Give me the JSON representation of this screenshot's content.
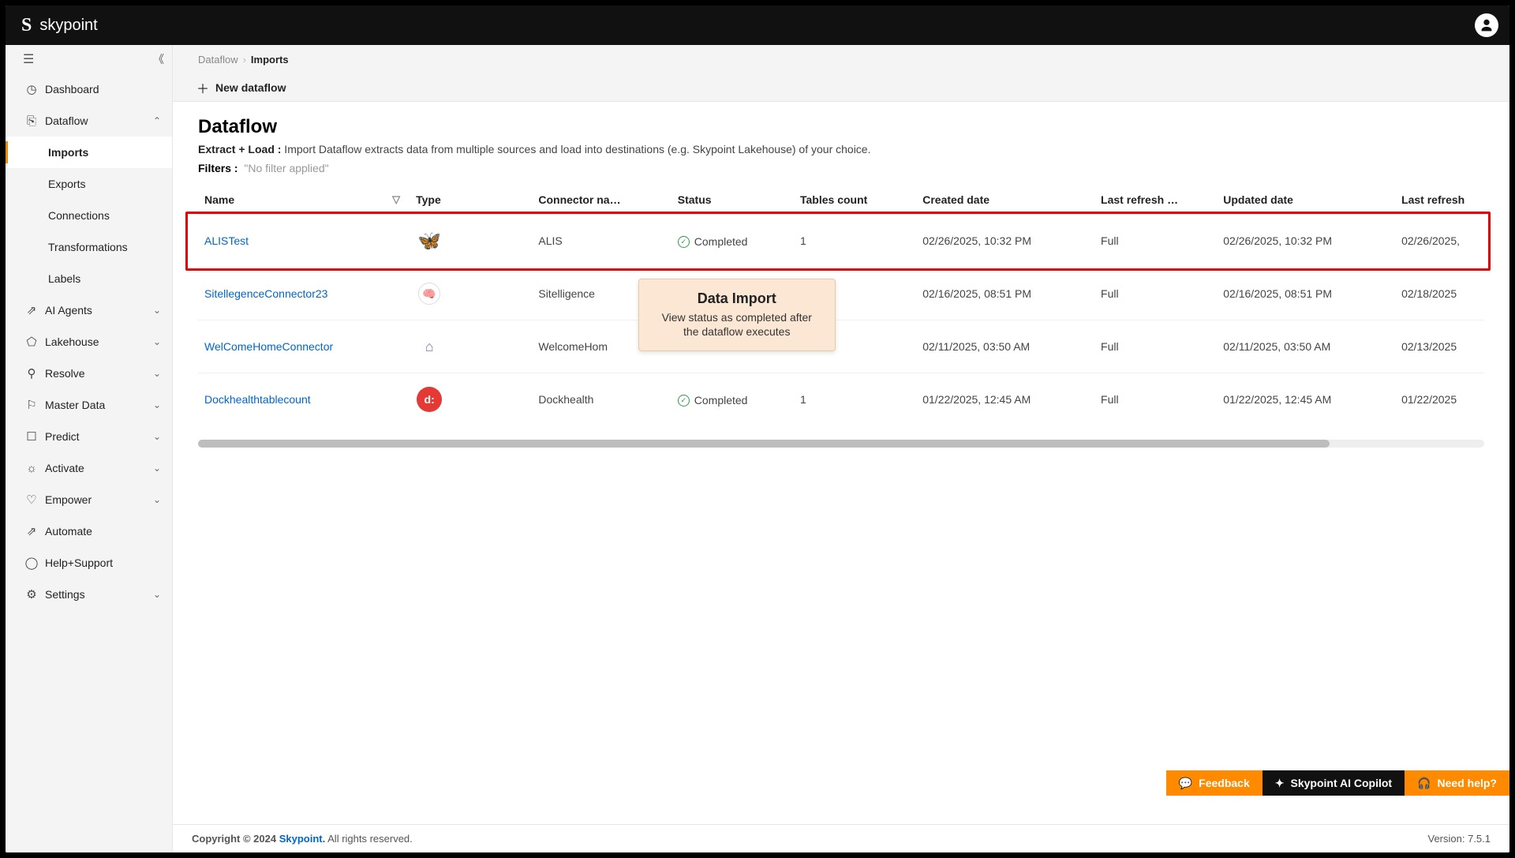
{
  "brand": {
    "logo": "S",
    "name": "skypoint"
  },
  "sidebar": {
    "items": [
      {
        "icon": "gauge",
        "label": "Dashboard",
        "expand": ""
      },
      {
        "icon": "flow",
        "label": "Dataflow",
        "expand": "up",
        "children": [
          {
            "label": "Imports",
            "active": true
          },
          {
            "label": "Exports"
          },
          {
            "label": "Connections"
          },
          {
            "label": "Transformations"
          },
          {
            "label": "Labels"
          }
        ]
      },
      {
        "icon": "agents",
        "label": "AI Agents",
        "expand": "down"
      },
      {
        "icon": "cube",
        "label": "Lakehouse",
        "expand": "down"
      },
      {
        "icon": "resolve",
        "label": "Resolve",
        "expand": "down"
      },
      {
        "icon": "people",
        "label": "Master Data",
        "expand": "down"
      },
      {
        "icon": "predict",
        "label": "Predict",
        "expand": "down"
      },
      {
        "icon": "bulb",
        "label": "Activate",
        "expand": "down"
      },
      {
        "icon": "shield",
        "label": "Empower",
        "expand": "down"
      },
      {
        "icon": "automate",
        "label": "Automate",
        "expand": ""
      },
      {
        "icon": "help",
        "label": "Help+Support",
        "expand": ""
      },
      {
        "icon": "gear",
        "label": "Settings",
        "expand": "down"
      }
    ]
  },
  "breadcrumbs": {
    "root": "Dataflow",
    "current": "Imports"
  },
  "toolbar": {
    "new_dataflow": "New dataflow"
  },
  "page": {
    "title": "Dataflow",
    "subtitle_b": "Extract + Load :",
    "subtitle": " Import Dataflow extracts data from multiple sources and load into destinations (e.g. Skypoint Lakehouse) of your choice.",
    "filters_label": "Filters :",
    "filters_value": "\"No filter applied\""
  },
  "table": {
    "headers": {
      "name": "Name",
      "type": "Type",
      "connector": "Connector na…",
      "status": "Status",
      "tables": "Tables count",
      "created": "Created date",
      "lastref": "Last refresh …",
      "updated": "Updated date",
      "lastdate": "Last refresh"
    },
    "rows": [
      {
        "name": "ALISTest",
        "icon": "butterfly",
        "connector": "ALIS",
        "status": "Completed",
        "tables": "1",
        "created": "02/26/2025, 10:32 PM",
        "lastref": "Full",
        "updated": "02/26/2025, 10:32 PM",
        "lastdate": "02/26/2025,"
      },
      {
        "name": "SitellegenceConnector23",
        "icon": "brain",
        "connector": "Sitelligence",
        "status": "",
        "tables": "",
        "created": "02/16/2025, 08:51 PM",
        "lastref": "Full",
        "updated": "02/16/2025, 08:51 PM",
        "lastdate": "02/18/2025"
      },
      {
        "name": "WelComeHomeConnector",
        "icon": "house",
        "connector": "WelcomeHom",
        "status": "",
        "tables": "",
        "created": "02/11/2025, 03:50 AM",
        "lastref": "Full",
        "updated": "02/11/2025, 03:50 AM",
        "lastdate": "02/13/2025"
      },
      {
        "name": "Dockhealthtablecount",
        "icon": "dock",
        "connector": "Dockhealth",
        "status": "Completed",
        "tables": "1",
        "created": "01/22/2025, 12:45 AM",
        "lastref": "Full",
        "updated": "01/22/2025, 12:45 AM",
        "lastdate": "01/22/2025"
      }
    ]
  },
  "tooltip": {
    "title": "Data Import",
    "body": "View status as completed after the dataflow executes"
  },
  "footer_actions": {
    "feedback": "Feedback",
    "copilot": "Skypoint AI Copilot",
    "help": "Need help?"
  },
  "footer": {
    "copyright_b": "Copyright © 2024 ",
    "brand": "Skypoint.",
    "rights": " All rights reserved.",
    "version": "Version: 7.5.1"
  },
  "icons": {
    "gauge": "◷",
    "flow": "⎘",
    "agents": "⇗",
    "cube": "⬠",
    "resolve": "⚲",
    "people": "⚐",
    "predict": "☐",
    "bulb": "☼",
    "shield": "♡",
    "automate": "⇗",
    "help": "◯",
    "gear": "⚙"
  }
}
